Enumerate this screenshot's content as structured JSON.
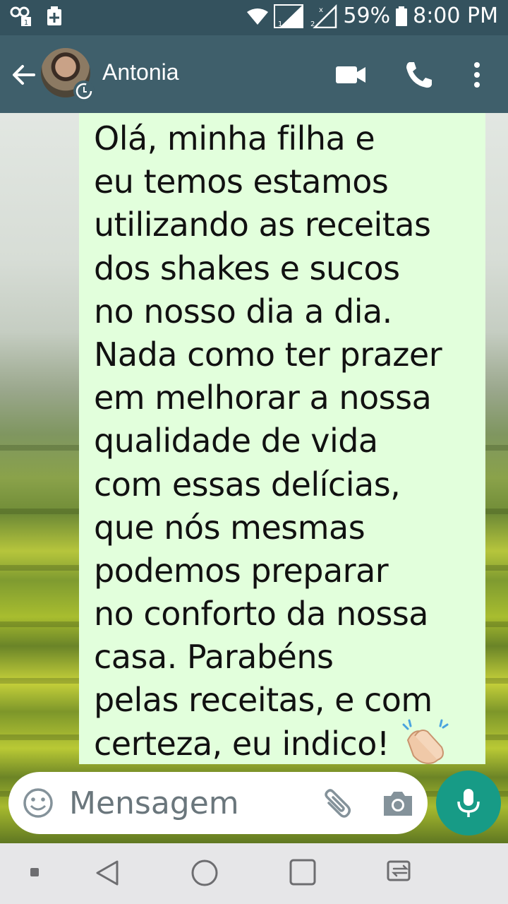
{
  "status_bar": {
    "battery_percent": "59%",
    "time": "8:00 PM",
    "icons": [
      "notification-icon",
      "add-icon",
      "wifi-icon",
      "signal-sim1-icon",
      "signal-sim2-icon",
      "battery-icon"
    ]
  },
  "header": {
    "contact_name": "Antonia",
    "icons": [
      "back-arrow-icon",
      "avatar",
      "video-call-icon",
      "phone-call-icon",
      "more-options-icon"
    ]
  },
  "message": {
    "lines": [
      "Olá, minha filha e",
      "eu temos estamos",
      "utilizando as receitas",
      "dos shakes e sucos",
      "no nosso dia a dia.",
      "Nada como ter prazer",
      "em melhorar a nossa",
      "qualidade de vida",
      "com essas delícias,",
      "que nós mesmas",
      "podemos preparar",
      "no conforto da nossa",
      "casa. Parabéns",
      "pelas receitas, e com",
      "certeza, eu indico!"
    ],
    "emoji": "clapping-hands-icon",
    "bubble_color": "#e2ffdc"
  },
  "composer": {
    "placeholder": "Mensagem",
    "value": "",
    "accent_color": "#179b86"
  },
  "nav_bar": {
    "items": [
      "square-dot-icon",
      "back-triangle-icon",
      "home-circle-icon",
      "recents-square-icon",
      "switch-sim-icon"
    ]
  }
}
